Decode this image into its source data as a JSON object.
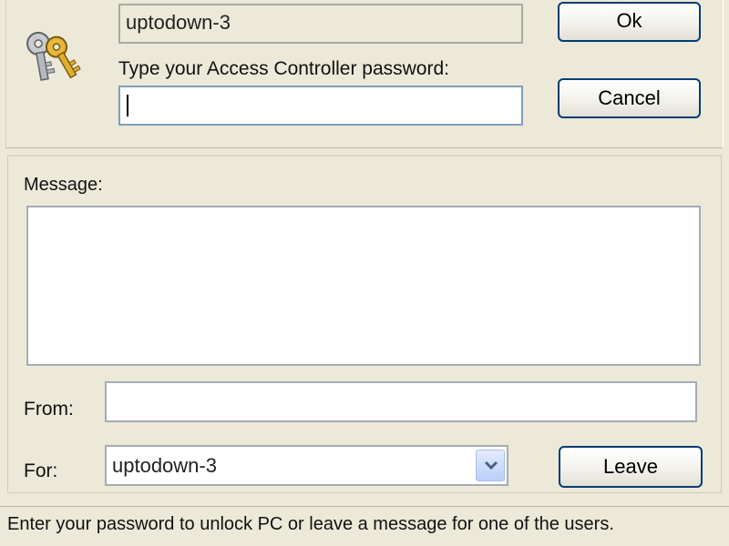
{
  "computer_name": "uptodown-3",
  "password": {
    "label": "Type your Access Controller password:",
    "value": ""
  },
  "buttons": {
    "ok": "Ok",
    "cancel": "Cancel",
    "leave": "Leave"
  },
  "message": {
    "label": "Message:",
    "value": ""
  },
  "from": {
    "label": "From:",
    "value": ""
  },
  "for": {
    "label": "For:",
    "selected": "uptodown-3"
  },
  "status_text": "Enter your password to unlock PC or leave a message for one of the users.",
  "icons": {
    "keys": "keys-icon",
    "dropdown": "chevron-down-icon"
  },
  "colors": {
    "window_bg": "#ECE9D8",
    "button_border": "#003C74",
    "input_border": "#7F9DB9",
    "dropdown_bg": "#C7D8F8"
  }
}
